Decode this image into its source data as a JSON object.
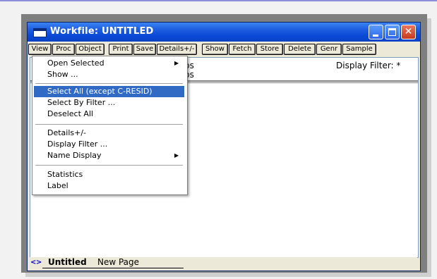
{
  "window": {
    "title": "Workfile: UNTITLED",
    "controls": {
      "close_glyph": "✕"
    }
  },
  "toolbar": {
    "buttons": [
      "View",
      "Proc",
      "Object",
      "Print",
      "Save",
      "Details+/-",
      "Show",
      "Fetch",
      "Store",
      "Delete",
      "Genr",
      "Sample"
    ]
  },
  "content": {
    "range_partial": "ps",
    "sample_partial": "ps",
    "display_filter": "Display Filter: *"
  },
  "menu": {
    "items": [
      {
        "label": "Open Selected",
        "submenu": true
      },
      {
        "label": "Show ...",
        "submenu": false
      },
      {
        "label": "Select All (except C-RESID)",
        "submenu": false,
        "selected": true
      },
      {
        "label": "Select By Filter ...",
        "submenu": false
      },
      {
        "label": "Deselect All",
        "submenu": false
      },
      {
        "label": "Details+/-",
        "submenu": false
      },
      {
        "label": "Display Filter ...",
        "submenu": false
      },
      {
        "label": "Name Display",
        "submenu": true
      },
      {
        "label": "Statistics",
        "submenu": false
      },
      {
        "label": "Label",
        "submenu": false
      }
    ],
    "submenu_glyph": "▶"
  },
  "tabs": {
    "arrow_left": "<",
    "arrow_right": ">",
    "items": [
      "Untitled",
      "New Page"
    ]
  },
  "colors": {
    "titlebar": "#0b48d6",
    "selection": "#316ac5",
    "frame_bg": "#7f7f7f"
  }
}
